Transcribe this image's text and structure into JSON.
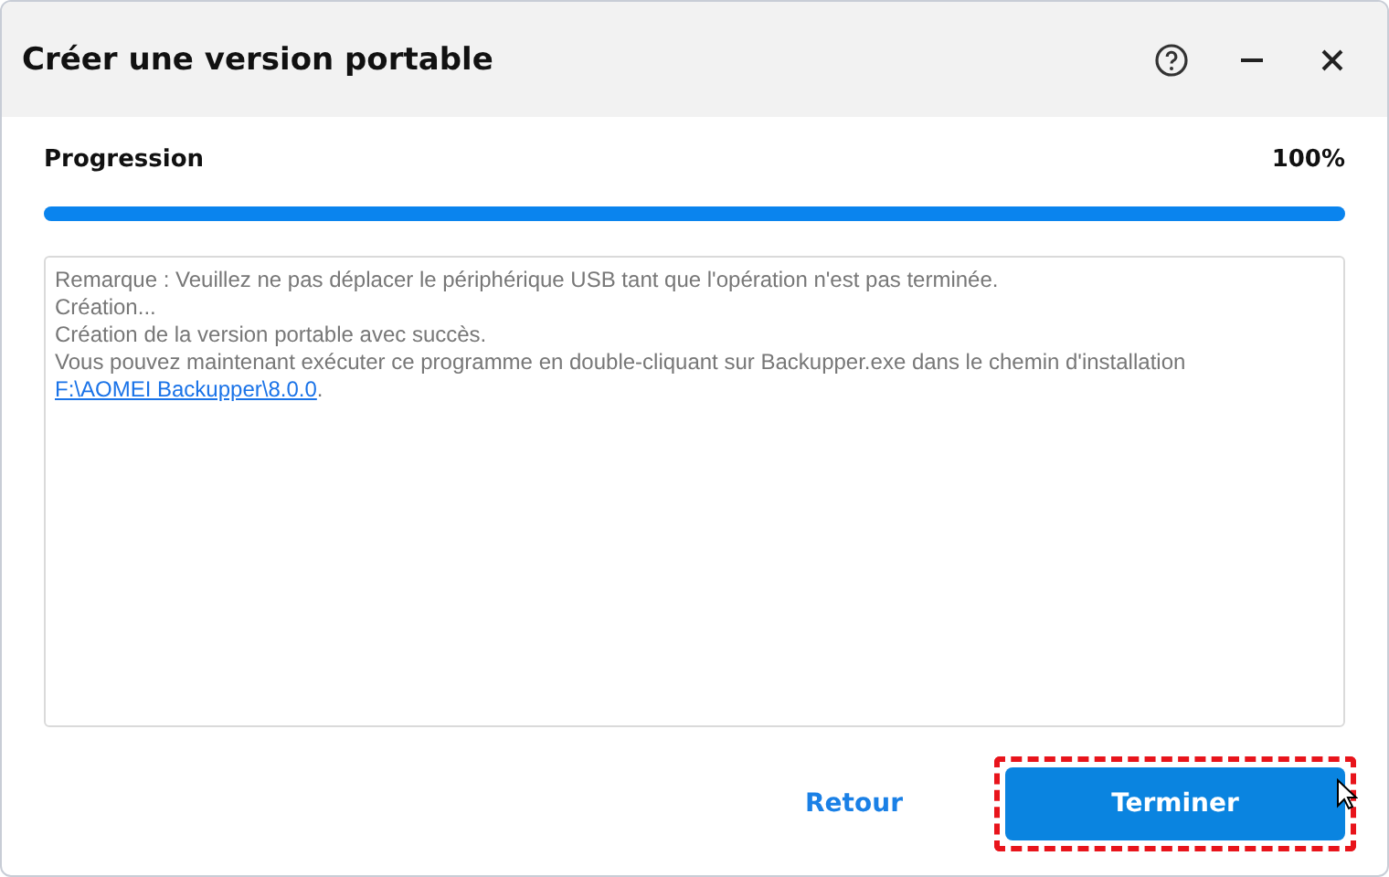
{
  "window": {
    "title": "Créer une version portable"
  },
  "progress": {
    "label": "Progression",
    "reading": "100%",
    "level": 1
  },
  "log": [
    {
      "text": "Remarque : Veuillez ne pas déplacer le périphérique USB tant que l'opération n'est pas terminée."
    },
    {
      "text": "Création..."
    },
    {
      "text": "Création de la version portable avec succès."
    },
    {
      "text": "Vous pouvez maintenant exécuter ce programme en double-cliquant sur Backupper.exe dans le chemin d'installation ",
      "link": "F:\\AOMEI Backupper\\8.0.0",
      "after": "."
    }
  ],
  "buttons": {
    "back": "Retour",
    "finish": "Terminer"
  }
}
